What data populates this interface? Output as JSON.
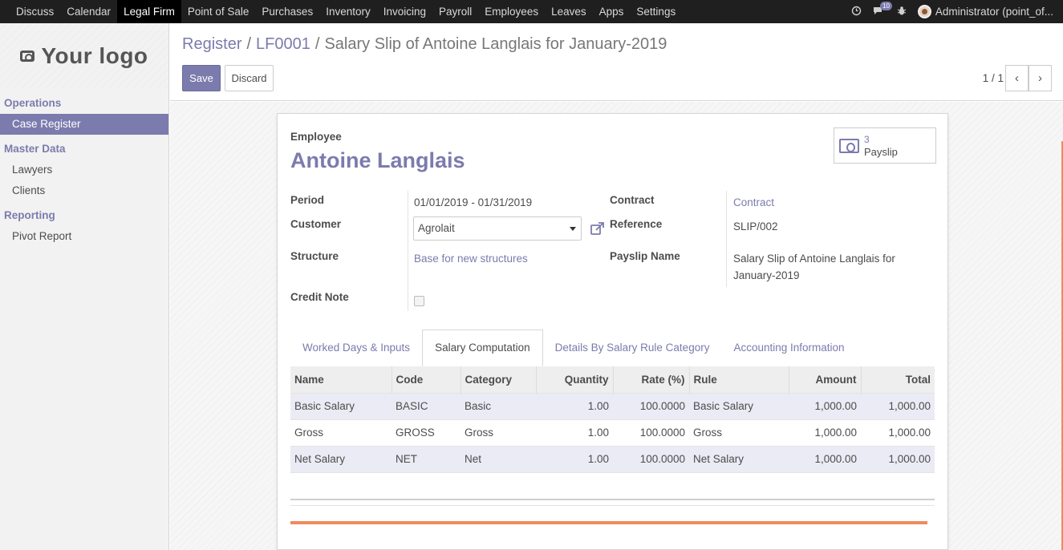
{
  "topnav": {
    "items": [
      "Discuss",
      "Calendar",
      "Legal Firm",
      "Point of Sale",
      "Purchases",
      "Inventory",
      "Invoicing",
      "Payroll",
      "Employees",
      "Leaves",
      "Apps",
      "Settings"
    ],
    "active": "Legal Firm",
    "message_count": "10",
    "user": "Administrator (point_of..."
  },
  "sidebar": {
    "logo": "Your logo",
    "sections": [
      {
        "title": "Operations",
        "items": [
          "Case Register"
        ]
      },
      {
        "title": "Master Data",
        "items": [
          "Lawyers",
          "Clients"
        ]
      },
      {
        "title": "Reporting",
        "items": [
          "Pivot Report"
        ]
      }
    ],
    "active_item": "Case Register"
  },
  "breadcrumb": {
    "register": "Register",
    "sep1": "/",
    "case": "LF0001",
    "sep2": "/",
    "current": "Salary Slip of Antoine Langlais for January-2019"
  },
  "buttons": {
    "save": "Save",
    "discard": "Discard"
  },
  "pager": {
    "value": "1 / 1",
    "prev": "‹",
    "next": "›"
  },
  "form": {
    "employee_label": "Employee",
    "employee_name": "Antoine Langlais",
    "payslip_count": "3",
    "payslip_label": "Payslip",
    "period_label": "Period",
    "period_value": "01/01/2019 - 01/31/2019",
    "customer_label": "Customer",
    "customer_value": "Agrolait",
    "structure_label": "Structure",
    "structure_value": "Base for new structures",
    "credit_note_label": "Credit Note",
    "contract_label": "Contract",
    "contract_value": "Contract",
    "reference_label": "Reference",
    "reference_value": "SLIP/002",
    "payslip_name_label": "Payslip Name",
    "payslip_name_line1": "Salary Slip of Antoine Langlais for",
    "payslip_name_line2": "January-2019"
  },
  "tabs": [
    "Worked Days & Inputs",
    "Salary Computation",
    "Details By Salary Rule Category",
    "Accounting Information"
  ],
  "active_tab": "Salary Computation",
  "table": {
    "headers": [
      "Name",
      "Code",
      "Category",
      "Quantity",
      "Rate (%)",
      "Rule",
      "Amount",
      "Total"
    ],
    "rows": [
      [
        "Basic Salary",
        "BASIC",
        "Basic",
        "1.00",
        "100.0000",
        "Basic Salary",
        "1,000.00",
        "1,000.00"
      ],
      [
        "Gross",
        "GROSS",
        "Gross",
        "1.00",
        "100.0000",
        "Gross",
        "1,000.00",
        "1,000.00"
      ],
      [
        "Net Salary",
        "NET",
        "Net",
        "1.00",
        "100.0000",
        "Net Salary",
        "1,000.00",
        "1,000.00"
      ]
    ]
  },
  "colors": {
    "accent": "#7c7bad",
    "topbar": "#1f1f1f",
    "highlight": "#f08a5d"
  }
}
